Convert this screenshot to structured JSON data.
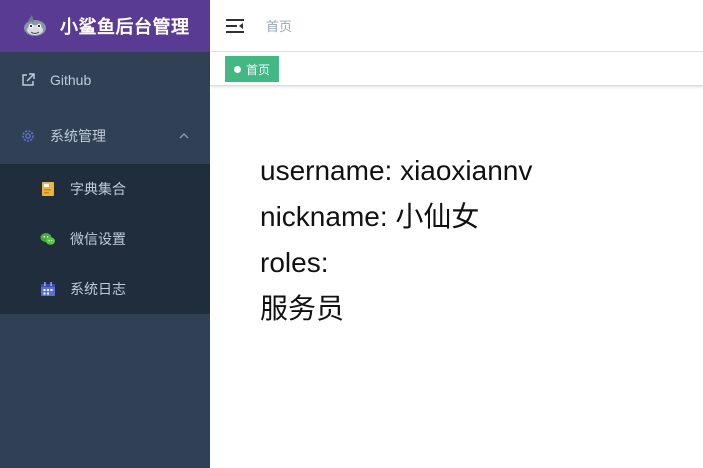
{
  "app": {
    "title": "小鲨鱼后台管理"
  },
  "sidebar": {
    "items": [
      {
        "label": "Github",
        "icon": "external-link-icon"
      },
      {
        "label": "系统管理",
        "icon": "gear-icon",
        "expanded": true,
        "children": [
          {
            "label": "字典集合",
            "icon": "dictionary-icon"
          },
          {
            "label": "微信设置",
            "icon": "wechat-icon"
          },
          {
            "label": "系统日志",
            "icon": "calendar-icon"
          }
        ]
      }
    ]
  },
  "navbar": {
    "breadcrumb": "首页"
  },
  "tags": [
    {
      "label": "首页",
      "active": true
    }
  ],
  "main": {
    "username": "username: xiaoxiannv",
    "nickname": "nickname: 小仙女",
    "roles_label": "roles:",
    "roles_value": "服务员"
  },
  "colors": {
    "sidebar_bg": "#304156",
    "submenu_bg": "#1f2d3d",
    "logo_bg": "#5a3b93",
    "tag_active": "#42b983",
    "menu_text": "#bfcbd9"
  }
}
